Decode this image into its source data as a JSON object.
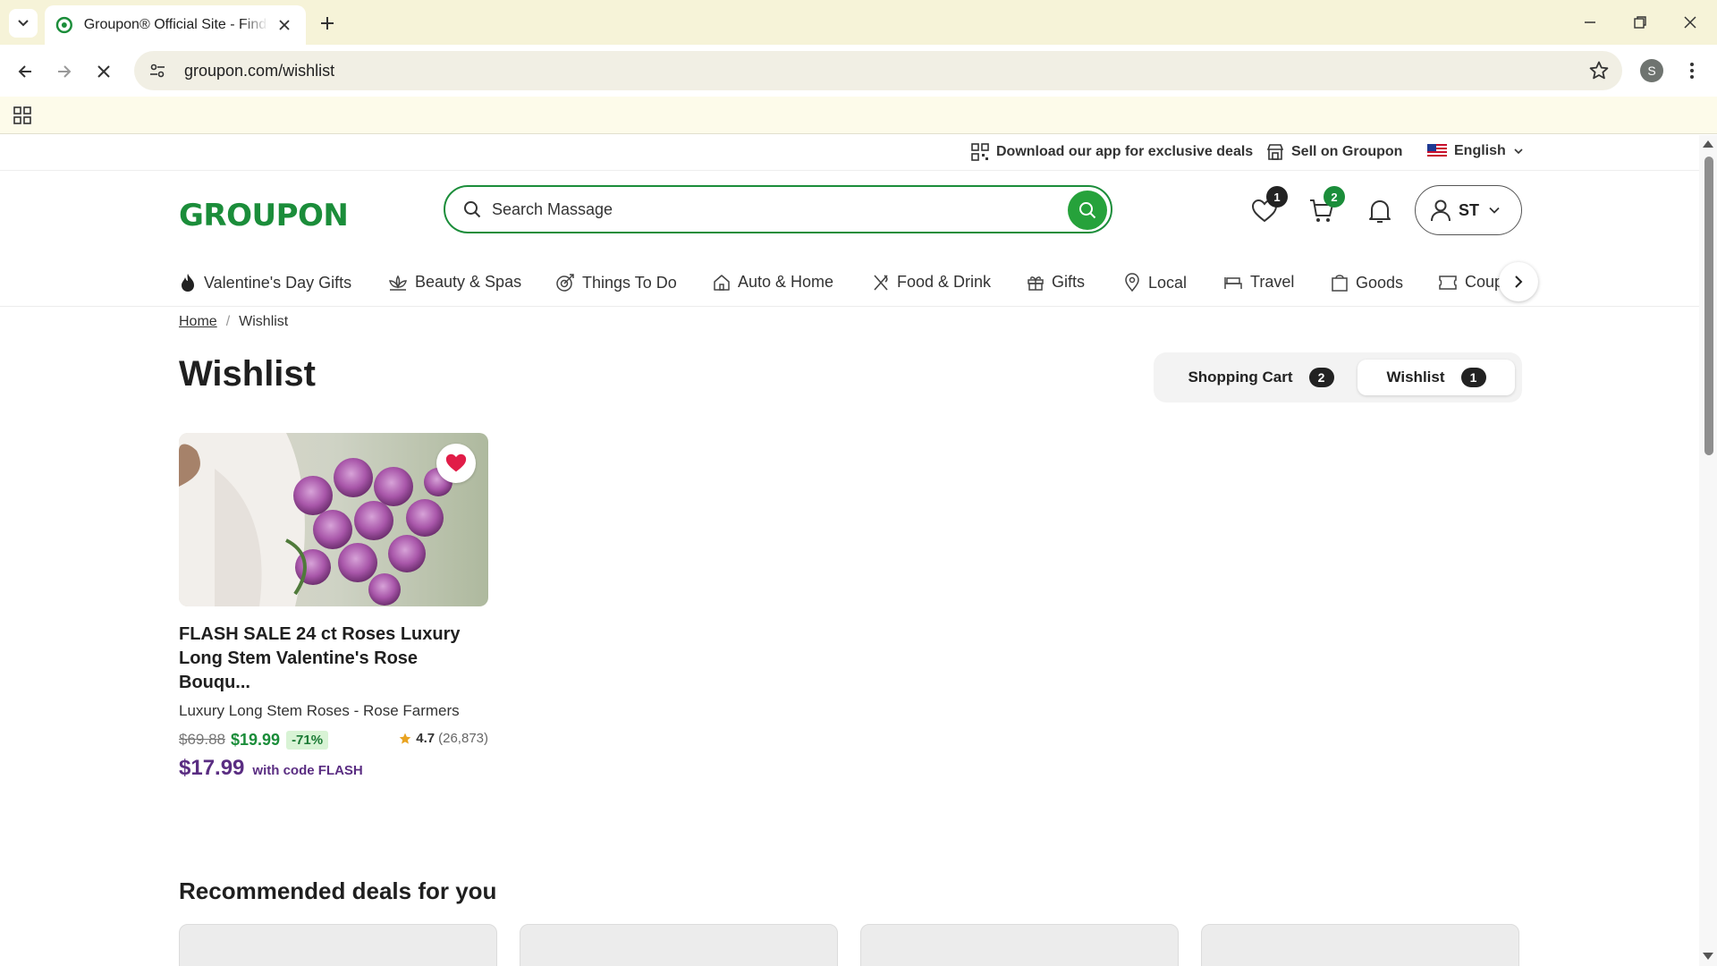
{
  "browser": {
    "tab_title": "Groupon® Official Site - Find Local Deals",
    "url": "groupon.com/wishlist",
    "profile_initial": "S"
  },
  "utility_bar": {
    "app_promo": "Download our app for exclusive deals",
    "sell": "Sell on Groupon",
    "language": "English"
  },
  "header": {
    "logo": "GROUPON",
    "search_placeholder": "Search Massage",
    "wishlist_count": "1",
    "cart_count": "2",
    "account_initials": "ST"
  },
  "categories": [
    {
      "label": "Valentine's Day Gifts",
      "icon": "flame-icon"
    },
    {
      "label": "Beauty & Spas",
      "icon": "lotus-icon"
    },
    {
      "label": "Things To Do",
      "icon": "target-icon"
    },
    {
      "label": "Auto & Home",
      "icon": "home-icon"
    },
    {
      "label": "Food & Drink",
      "icon": "utensils-icon"
    },
    {
      "label": "Gifts",
      "icon": "gift-icon"
    },
    {
      "label": "Local",
      "icon": "location-pin-icon"
    },
    {
      "label": "Travel",
      "icon": "bed-icon"
    },
    {
      "label": "Goods",
      "icon": "shopping-bag-icon"
    },
    {
      "label": "Coupons",
      "icon": "coupon-icon"
    }
  ],
  "breadcrumb": {
    "home": "Home",
    "current": "Wishlist"
  },
  "page_title": "Wishlist",
  "toggle": {
    "cart_label": "Shopping Cart",
    "cart_count": "2",
    "wishlist_label": "Wishlist",
    "wishlist_count": "1"
  },
  "deal": {
    "title": "FLASH SALE 24 ct Roses Luxury Long Stem Valentine's Rose Bouqu...",
    "merchant": "Luxury Long Stem Roses - Rose Farmers",
    "old_price": "$69.88",
    "new_price": "$19.99",
    "discount": "-71%",
    "rating": "4.7",
    "rating_count": "(26,873)",
    "code_price": "$17.99",
    "code_text": "with code FLASH"
  },
  "recommended_title": "Recommended deals for you",
  "colors": {
    "brand_green": "#1b8d3a",
    "promo_purple": "#5a2d82",
    "heart_red": "#e11d48"
  }
}
